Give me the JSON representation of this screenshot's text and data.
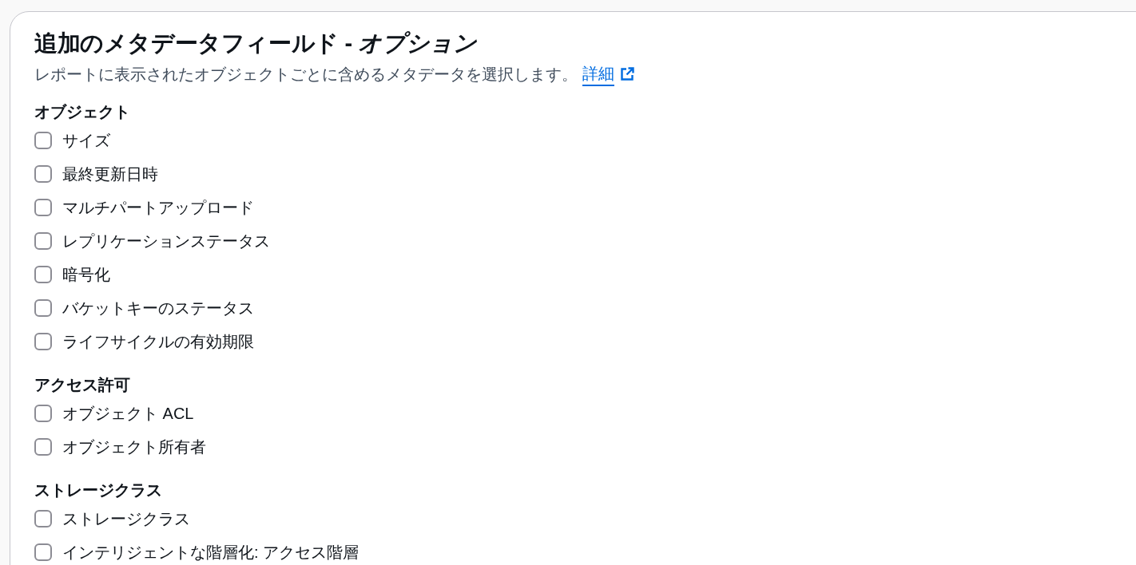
{
  "panel": {
    "title": "追加のメタデータフィールド - *オプション*",
    "description": "レポートに表示されたオブジェクトごとに含めるメタデータを選択します。",
    "link": "詳細"
  },
  "sections": [
    {
      "heading": "オブジェクト",
      "options": [
        {
          "label": "サイズ",
          "checked": false
        },
        {
          "label": "最終更新日時",
          "checked": false
        },
        {
          "label": "マルチパートアップロード",
          "checked": false
        },
        {
          "label": "レプリケーションステータス",
          "checked": false
        },
        {
          "label": "暗号化",
          "checked": false
        },
        {
          "label": "バケットキーのステータス",
          "checked": false
        },
        {
          "label": "ライフサイクルの有効期限",
          "checked": false
        }
      ]
    },
    {
      "heading": "アクセス許可",
      "options": [
        {
          "label": "オブジェクト ACL",
          "checked": false
        },
        {
          "label": "オブジェクト所有者",
          "checked": false
        }
      ]
    },
    {
      "heading": "ストレージクラス",
      "options": [
        {
          "label": "ストレージクラス",
          "checked": false
        },
        {
          "label": "インテリジェントな階層化: アクセス階層",
          "checked": false
        }
      ]
    }
  ]
}
